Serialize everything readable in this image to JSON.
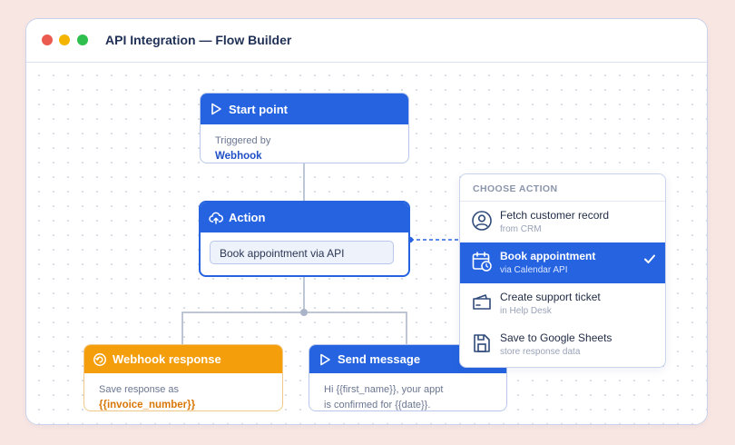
{
  "window": {
    "title": "API Integration — Flow Builder"
  },
  "start_node": {
    "title": "Start point",
    "label": "Triggered by",
    "trigger": "Webhook"
  },
  "action_node": {
    "title": "Action",
    "field_value": "Book appointment via API"
  },
  "webhook_node": {
    "title": "Webhook response",
    "text": "Save response as",
    "variable": "{{invoice_number}}"
  },
  "send_node": {
    "title": "Send message",
    "line1": "Hi {{first_name}}, your appt",
    "line2": "is confirmed for {{date}}."
  },
  "choose_panel": {
    "heading": "CHOOSE ACTION",
    "options": [
      {
        "label": "Fetch customer record",
        "sub": "from CRM",
        "icon": "user-circle-icon",
        "selected": false
      },
      {
        "label": "Book appointment",
        "sub": "via Calendar API",
        "icon": "calendar-clock-icon",
        "selected": true
      },
      {
        "label": "Create support ticket",
        "sub": "in Help Desk",
        "icon": "ticket-icon",
        "selected": false
      },
      {
        "label": "Save to Google Sheets",
        "sub": "store response data",
        "icon": "document-save-icon",
        "selected": false
      }
    ]
  },
  "colors": {
    "primary": "#2563e0",
    "warning": "#f59e0b",
    "background": "#f8e6e3"
  }
}
